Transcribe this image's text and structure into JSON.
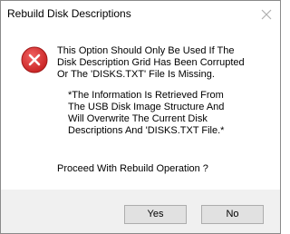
{
  "window": {
    "title": "Rebuild Disk Descriptions",
    "close_glyph": "✕"
  },
  "message": {
    "main": "This Option Should Only Be Used If The\nDisk Description Grid Has Been Corrupted\nOr The 'DISKS.TXT' File Is Missing.",
    "info": "*The Information Is Retrieved From\nThe USB Disk Image Structure And\nWill Overwrite The Current Disk\nDescriptions And 'DISKS.TXT File.*",
    "prompt": "Proceed With Rebuild Operation ?"
  },
  "buttons": {
    "yes_label": "Yes",
    "no_label": "No"
  },
  "icons": {
    "error": "error-icon",
    "close": "close-icon"
  },
  "colors": {
    "error_red": "#d32f2f",
    "footer_bg": "#f0f0f0",
    "button_bg": "#e1e1e1",
    "button_border": "#adadad"
  }
}
